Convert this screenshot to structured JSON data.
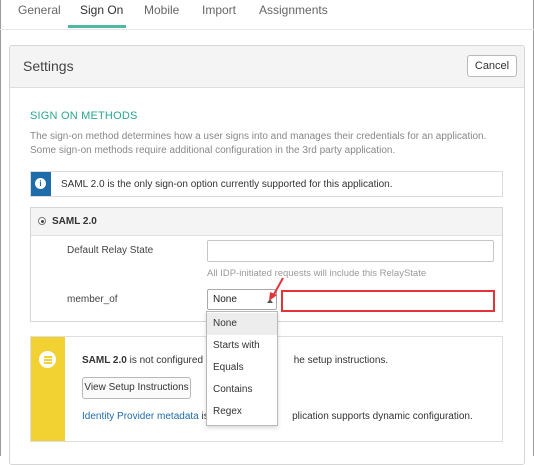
{
  "tabs": [
    {
      "label": "General"
    },
    {
      "label": "Sign On",
      "active": true
    },
    {
      "label": "Mobile"
    },
    {
      "label": "Import"
    },
    {
      "label": "Assignments"
    }
  ],
  "settings": {
    "title": "Settings",
    "cancel_label": "Cancel"
  },
  "sign_on_methods": {
    "heading": "SIGN ON METHODS",
    "description": "The sign-on method determines how a user signs into and manages their credentials for an application. Some sign-on methods require additional configuration in the 3rd party application.",
    "info_text": "SAML 2.0 is the only sign-on option currently supported for this application."
  },
  "saml": {
    "title": "SAML 2.0",
    "relay_state_label": "Default Relay State",
    "relay_state_value": "",
    "relay_state_helper": "All IDP-initiated requests will include this RelayState",
    "member_of_label": "member_of",
    "member_of_selected": "None",
    "member_of_value": "",
    "options": [
      "None",
      "Starts with",
      "Equals",
      "Contains",
      "Regex"
    ]
  },
  "setup": {
    "bold_prefix": "SAML 2.0",
    "line1_a": " is not configured unt",
    "line1_b": "he setup instructions.",
    "button_label": "View Setup Instructions",
    "metadata_link": "Identity Provider metadata",
    "line3_a": " is av",
    "line3_b": "plication supports dynamic configuration."
  },
  "colors": {
    "accent": "#4fb8a5",
    "section_heading": "#2aa690",
    "info": "#1f6cab",
    "warning": "#f1d232",
    "highlight": "#e3343a"
  }
}
